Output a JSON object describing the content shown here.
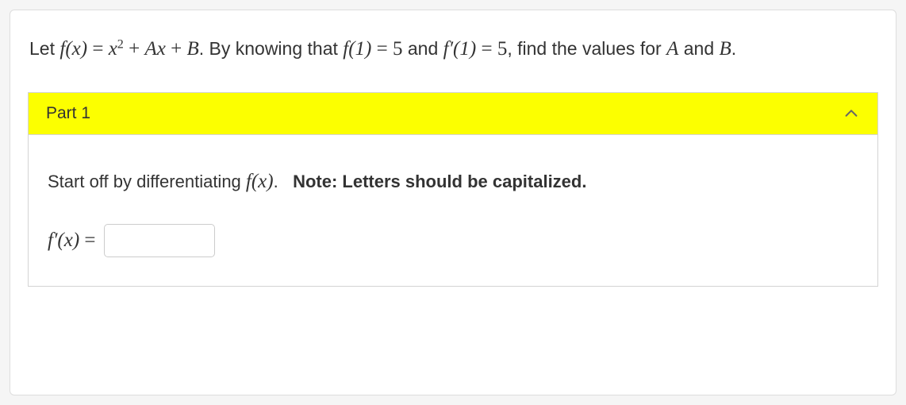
{
  "question": {
    "prefix": "Let ",
    "func_def_lhs": "f(x)",
    "func_def_eq": " = ",
    "func_def_rhs_x2": "x",
    "func_def_rhs_exp": "2",
    "func_def_rhs_plus1": " + ",
    "func_def_rhs_Ax": "Ax",
    "func_def_rhs_plus2": " + ",
    "func_def_rhs_B": "B",
    "middle1": ". By knowing that ",
    "cond1_lhs": "f(1)",
    "cond1_eq": " = ",
    "cond1_rhs": "5",
    "middle2": " and ",
    "cond2_lhs": "f′(1)",
    "cond2_eq": " = ",
    "cond2_rhs": "5",
    "suffix": ", find the values for ",
    "varA": "A",
    "and": " and ",
    "varB": "B",
    "period": "."
  },
  "part": {
    "label": "Part 1",
    "instruction_prefix": "Start off by differentiating ",
    "instruction_func": "f(x)",
    "instruction_period": ".",
    "note": "Note: Letters should be capitalized.",
    "answer_label": "f′(x)",
    "answer_eq": " = ",
    "input_value": ""
  }
}
